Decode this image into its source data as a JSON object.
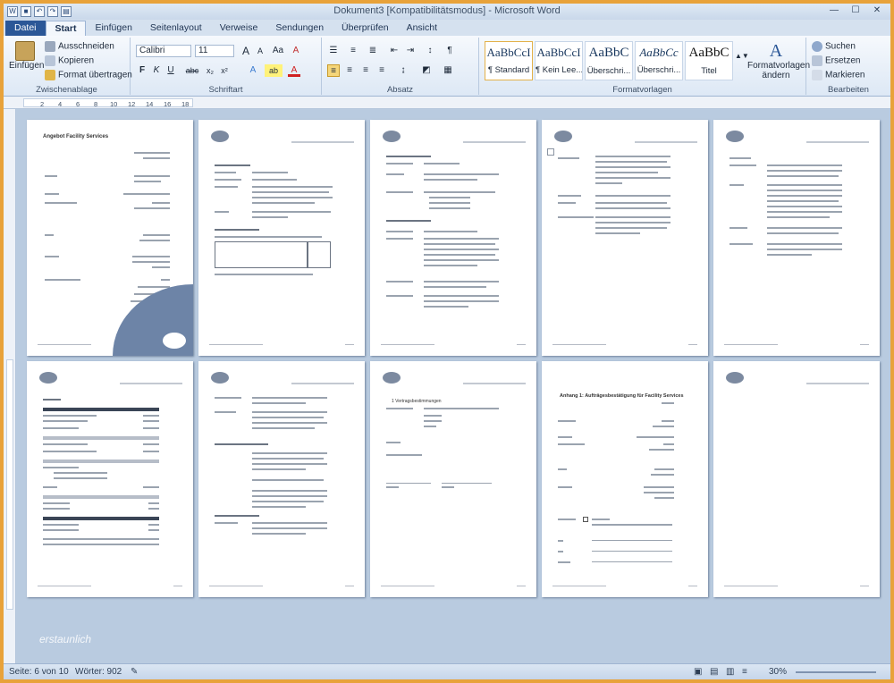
{
  "titlebar": {
    "title": "Dokument3 [Kompatibilitätsmodus] - Microsoft Word",
    "buttons": [
      "—",
      "☐",
      "✕"
    ]
  },
  "tabs": [
    {
      "label": "Datei"
    },
    {
      "label": "Start"
    },
    {
      "label": "Einfügen"
    },
    {
      "label": "Seitenlayout"
    },
    {
      "label": "Verweise"
    },
    {
      "label": "Sendungen"
    },
    {
      "label": "Überprüfen"
    },
    {
      "label": "Ansicht"
    }
  ],
  "ribbon": {
    "clipboard": {
      "paste": "Einfügen",
      "cut": "Ausschneiden",
      "copy": "Kopieren",
      "format_painter": "Format übertragen",
      "label": "Zwischenablage"
    },
    "font": {
      "name": "Calibri",
      "size": "11",
      "label": "Schriftart",
      "bold": "F",
      "italic": "K",
      "underline": "U",
      "strike": "abc",
      "sub": "x₂",
      "sup": "x²",
      "grow": "A",
      "shrink": "A",
      "case": "Aa",
      "clear": "A",
      "highlight": "ab",
      "color": "A"
    },
    "paragraph": {
      "label": "Absatz",
      "pilcrow": "¶"
    },
    "styles": {
      "label": "Formatvorlagen",
      "items": [
        {
          "sample": "AaBbCcI",
          "name": "¶ Standard"
        },
        {
          "sample": "AaBbCcI",
          "name": "¶ Kein Lee..."
        },
        {
          "sample": "AaBbC",
          "name": "Überschri..."
        },
        {
          "sample": "AaBbCc",
          "name": "Überschri..."
        },
        {
          "sample": "AaBbC",
          "name": "Titel"
        }
      ],
      "change": "Formatvorlagen ändern"
    },
    "editing": {
      "label": "Bearbeiten",
      "search": "Suchen",
      "replace": "Ersetzen",
      "select": "Markieren"
    }
  },
  "ruler": {
    "ticks": [
      "2",
      "4",
      "6",
      "8",
      "10",
      "12",
      "14",
      "16",
      "18"
    ]
  },
  "pages": {
    "p1_title": "Angebot Facility Services",
    "p9_title": "Anhang 1: Aufträgesbestätigung für Facility Services",
    "p8_heading": "1 Vertragsbestimmungen"
  },
  "statusbar": {
    "page": "Seite: 6 von 10",
    "words": "Wörter: 902",
    "zoom": "30%"
  },
  "watermark": "erstaunlich"
}
